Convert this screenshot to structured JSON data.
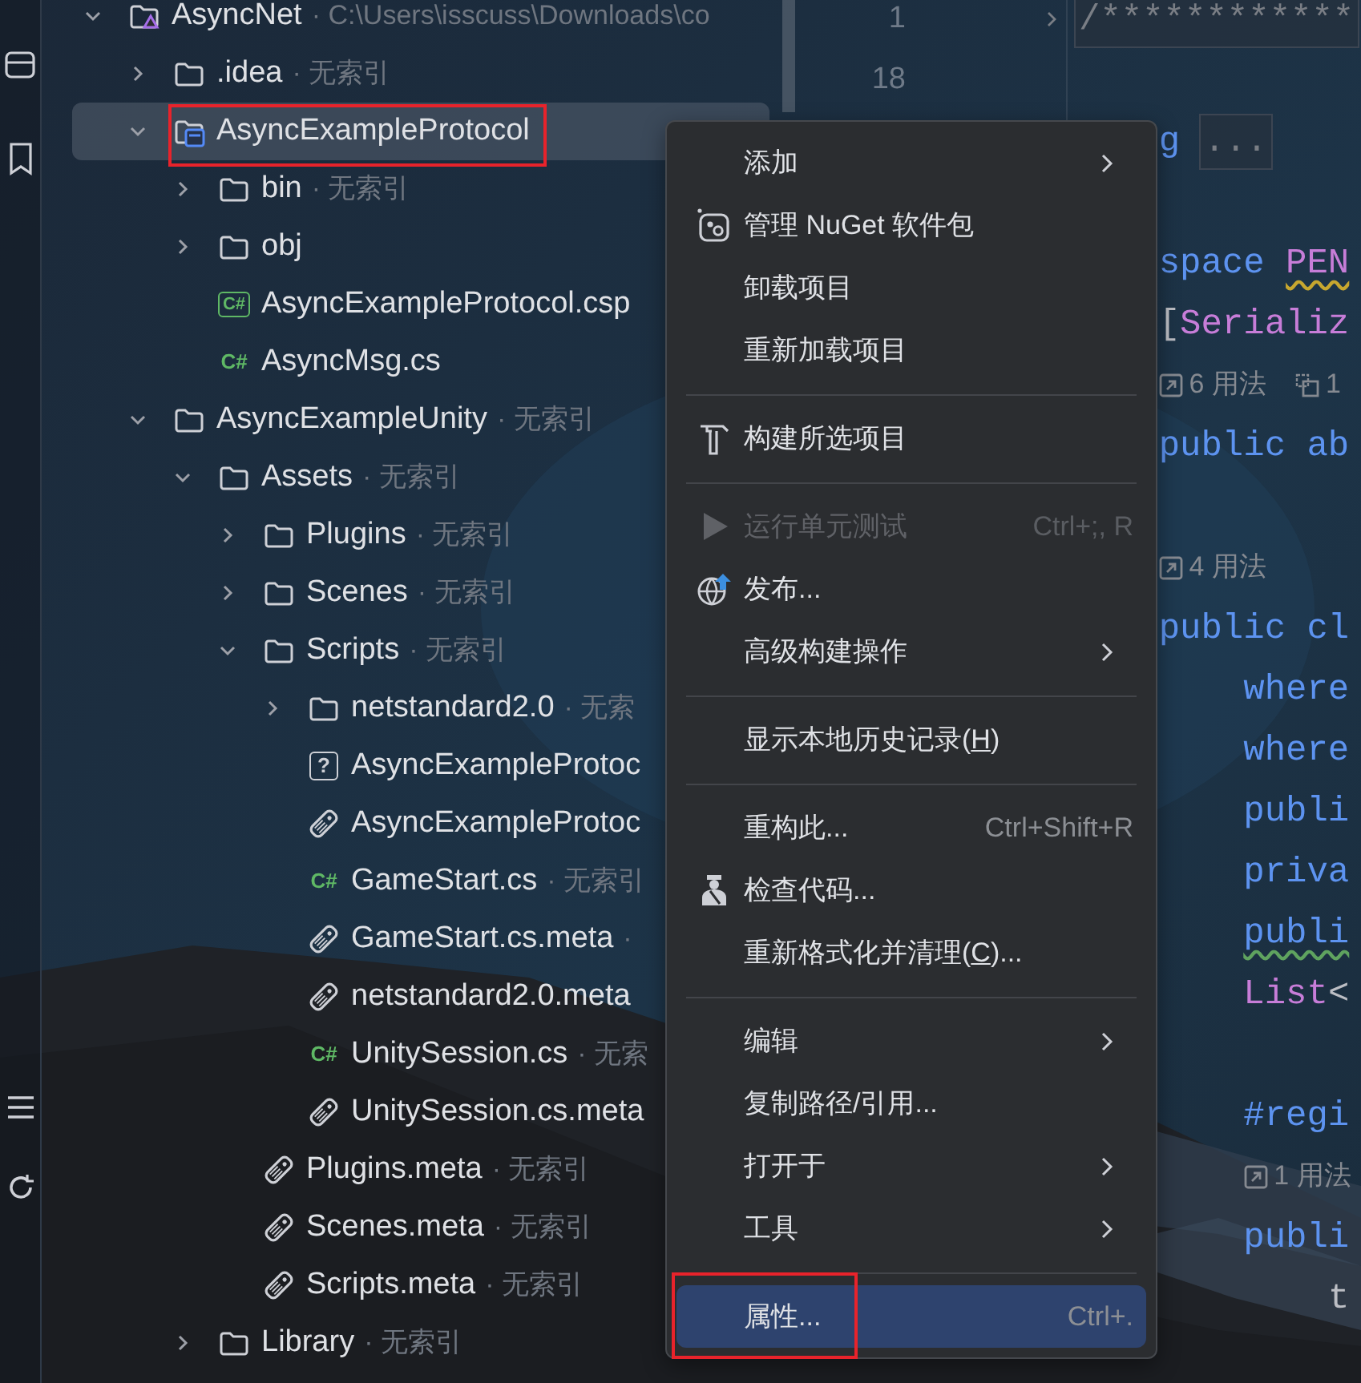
{
  "tree": [
    {
      "name": "AsyncNet",
      "kind": "solution",
      "note": "· C:\\Users\\isscuss\\Downloads\\co",
      "expanded": true,
      "selected": false,
      "annotated": false,
      "children": [
        {
          "name": ".idea",
          "kind": "folder",
          "note": "· 无索引",
          "expanded": false,
          "selected": false,
          "annotated": false
        },
        {
          "name": "AsyncExampleProtocol",
          "kind": "project",
          "expanded": true,
          "selected": true,
          "annotated": true,
          "children": [
            {
              "name": "bin",
              "kind": "folder",
              "note": "· 无索引",
              "expanded": false,
              "selected": false,
              "annotated": false
            },
            {
              "name": "obj",
              "kind": "folder",
              "expanded": false,
              "selected": false,
              "annotated": false
            },
            {
              "name": "AsyncExampleProtocol.csp",
              "kind": "csproj",
              "badge": "C#",
              "selected": false,
              "annotated": false
            },
            {
              "name": "AsyncMsg.cs",
              "kind": "cs",
              "badge": "C#",
              "selected": false,
              "annotated": false
            }
          ]
        },
        {
          "name": "AsyncExampleUnity",
          "kind": "folder",
          "note": "· 无索引",
          "expanded": true,
          "selected": false,
          "annotated": false,
          "children": [
            {
              "name": "Assets",
              "kind": "folder",
              "note": "· 无索引",
              "expanded": true,
              "selected": false,
              "annotated": false,
              "children": [
                {
                  "name": "Plugins",
                  "kind": "folder",
                  "note": "· 无索引",
                  "expanded": false,
                  "selected": false,
                  "annotated": false
                },
                {
                  "name": "Scenes",
                  "kind": "folder",
                  "note": "· 无索引",
                  "expanded": false,
                  "selected": false,
                  "annotated": false
                },
                {
                  "name": "Scripts",
                  "kind": "folder",
                  "note": "· 无索引",
                  "expanded": true,
                  "selected": false,
                  "annotated": false,
                  "children": [
                    {
                      "name": "netstandard2.0",
                      "kind": "folder",
                      "note": "· 无索",
                      "expanded": false,
                      "selected": false,
                      "annotated": false
                    },
                    {
                      "name": "AsyncExampleProtoc",
                      "kind": "unknown",
                      "badge": "?",
                      "selected": false,
                      "annotated": false
                    },
                    {
                      "name": "AsyncExampleProtoc",
                      "kind": "meta",
                      "selected": false,
                      "annotated": false
                    },
                    {
                      "name": "GameStart.cs",
                      "kind": "cs",
                      "badge": "C#",
                      "note": "· 无索引",
                      "selected": false,
                      "annotated": false
                    },
                    {
                      "name": "GameStart.cs.meta",
                      "kind": "meta",
                      "note": "·",
                      "selected": false,
                      "annotated": false
                    },
                    {
                      "name": "netstandard2.0.meta",
                      "kind": "meta",
                      "selected": false,
                      "annotated": false
                    },
                    {
                      "name": "UnitySession.cs",
                      "kind": "cs",
                      "badge": "C#",
                      "note": "· 无索",
                      "selected": false,
                      "annotated": false
                    },
                    {
                      "name": "UnitySession.cs.meta",
                      "kind": "meta",
                      "selected": false,
                      "annotated": false
                    }
                  ]
                },
                {
                  "name": "Plugins.meta",
                  "kind": "meta",
                  "note": "· 无索引",
                  "selected": false,
                  "annotated": false
                },
                {
                  "name": "Scenes.meta",
                  "kind": "meta",
                  "note": "· 无索引",
                  "selected": false,
                  "annotated": false
                },
                {
                  "name": "Scripts.meta",
                  "kind": "meta",
                  "note": "· 无索引",
                  "selected": false,
                  "annotated": false
                }
              ]
            },
            {
              "name": "Library",
              "kind": "folder",
              "note": "· 无索引",
              "expanded": false,
              "selected": false,
              "annotated": false
            }
          ]
        }
      ]
    }
  ],
  "editor": {
    "lines": [
      {
        "kind": "code",
        "line_number": "1",
        "fold": true,
        "segments": [
          {
            "text": "/************",
            "kind": "folded"
          }
        ]
      },
      {
        "kind": "blank",
        "line_number": "18"
      },
      {
        "kind": "code",
        "segments": [
          {
            "text": "    g",
            "kind": "keyword"
          },
          {
            "text": "...",
            "kind": "folded"
          }
        ]
      },
      {
        "kind": "blank"
      },
      {
        "kind": "code",
        "segments": [
          {
            "text": "    space ",
            "kind": "keyword"
          },
          {
            "text": "PEN",
            "kind": "type",
            "squiggle": true,
            "color": "#c7a72f"
          }
        ]
      },
      {
        "kind": "code",
        "segments": [
          {
            "text": "    [",
            "kind": "plain"
          },
          {
            "text": "Serializ",
            "kind": "type"
          }
        ]
      },
      {
        "kind": "hint",
        "hints": [
          {
            "kind": "usages",
            "text": "6 用法"
          },
          {
            "kind": "implementations",
            "text": "1"
          }
        ]
      },
      {
        "kind": "code",
        "segments": [
          {
            "text": "    public ab",
            "kind": "keyword"
          }
        ]
      },
      {
        "kind": "blank"
      },
      {
        "kind": "hint",
        "hints": [
          {
            "kind": "usages",
            "text": "4 用法"
          }
        ]
      },
      {
        "kind": "code",
        "segments": [
          {
            "text": "    public cl",
            "kind": "keyword"
          }
        ]
      },
      {
        "kind": "code",
        "segments": [
          {
            "text": "        where",
            "kind": "keyword"
          }
        ]
      },
      {
        "kind": "code",
        "segments": [
          {
            "text": "        where",
            "kind": "keyword"
          }
        ]
      },
      {
        "kind": "code",
        "segments": [
          {
            "text": "        publi",
            "kind": "keyword"
          }
        ]
      },
      {
        "kind": "code",
        "segments": [
          {
            "text": "        priva",
            "kind": "keyword"
          }
        ]
      },
      {
        "kind": "code",
        "segments": [
          {
            "text": "        publi",
            "kind": "keyword",
            "squiggle": true,
            "color": "#5fa35f"
          }
        ]
      },
      {
        "kind": "code",
        "segments": [
          {
            "text": "        List",
            "kind": "type"
          },
          {
            "text": "<",
            "kind": "plain"
          }
        ]
      },
      {
        "kind": "blank"
      },
      {
        "kind": "code",
        "segments": [
          {
            "text": "        #regi",
            "kind": "keyword"
          }
        ]
      },
      {
        "kind": "hint",
        "hints": [
          {
            "kind": "usages",
            "text": "1 用法"
          }
        ]
      },
      {
        "kind": "code",
        "segments": [
          {
            "text": "        publi",
            "kind": "keyword"
          }
        ]
      },
      {
        "kind": "code",
        "segments": [
          {
            "text": "            t",
            "kind": "plain"
          }
        ]
      }
    ]
  },
  "context_menu": [
    {
      "kind": "item",
      "label": "添加",
      "submenu": true,
      "disabled": false,
      "selected": false,
      "annotated": false
    },
    {
      "kind": "item",
      "label": "管理 NuGet 软件包",
      "submenu": false,
      "disabled": false,
      "selected": false,
      "annotated": false
    },
    {
      "kind": "item",
      "label": "卸载项目",
      "submenu": false,
      "disabled": false,
      "selected": false,
      "annotated": false
    },
    {
      "kind": "item",
      "label": "重新加载项目",
      "submenu": false,
      "disabled": false,
      "selected": false,
      "annotated": false
    },
    {
      "kind": "separator"
    },
    {
      "kind": "item",
      "label": "构建所选项目",
      "submenu": false,
      "disabled": false,
      "selected": false,
      "annotated": false
    },
    {
      "kind": "separator"
    },
    {
      "kind": "item",
      "label": "运行单元测试",
      "shortcut": "Ctrl+;, R",
      "submenu": false,
      "disabled": true,
      "selected": false,
      "annotated": false
    },
    {
      "kind": "item",
      "label": "发布...",
      "submenu": false,
      "disabled": false,
      "selected": false,
      "annotated": false
    },
    {
      "kind": "item",
      "label": "高级构建操作",
      "submenu": true,
      "disabled": false,
      "selected": false,
      "annotated": false
    },
    {
      "kind": "separator"
    },
    {
      "kind": "item",
      "label": "显示本地历史记录(H)",
      "mnemonic": true,
      "submenu": false,
      "disabled": false,
      "selected": false,
      "annotated": false
    },
    {
      "kind": "separator"
    },
    {
      "kind": "item",
      "label": "重构此...",
      "shortcut": "Ctrl+Shift+R",
      "submenu": false,
      "disabled": false,
      "selected": false,
      "annotated": false
    },
    {
      "kind": "item",
      "label": "检查代码...",
      "submenu": false,
      "disabled": false,
      "selected": false,
      "annotated": false
    },
    {
      "kind": "item",
      "label": "重新格式化并清理(C)...",
      "mnemonic": true,
      "submenu": false,
      "disabled": false,
      "selected": false,
      "annotated": false
    },
    {
      "kind": "separator"
    },
    {
      "kind": "item",
      "label": "编辑",
      "submenu": true,
      "disabled": false,
      "selected": false,
      "annotated": false
    },
    {
      "kind": "item",
      "label": "复制路径/引用...",
      "submenu": false,
      "disabled": false,
      "selected": false,
      "annotated": false
    },
    {
      "kind": "item",
      "label": "打开于",
      "submenu": true,
      "disabled": false,
      "selected": false,
      "annotated": false
    },
    {
      "kind": "item",
      "label": "工具",
      "submenu": true,
      "disabled": false,
      "selected": false,
      "annotated": false
    },
    {
      "kind": "separator"
    },
    {
      "kind": "item",
      "label": "属性...",
      "shortcut": "Ctrl+.",
      "submenu": false,
      "disabled": false,
      "selected": true,
      "annotated": true
    }
  ]
}
